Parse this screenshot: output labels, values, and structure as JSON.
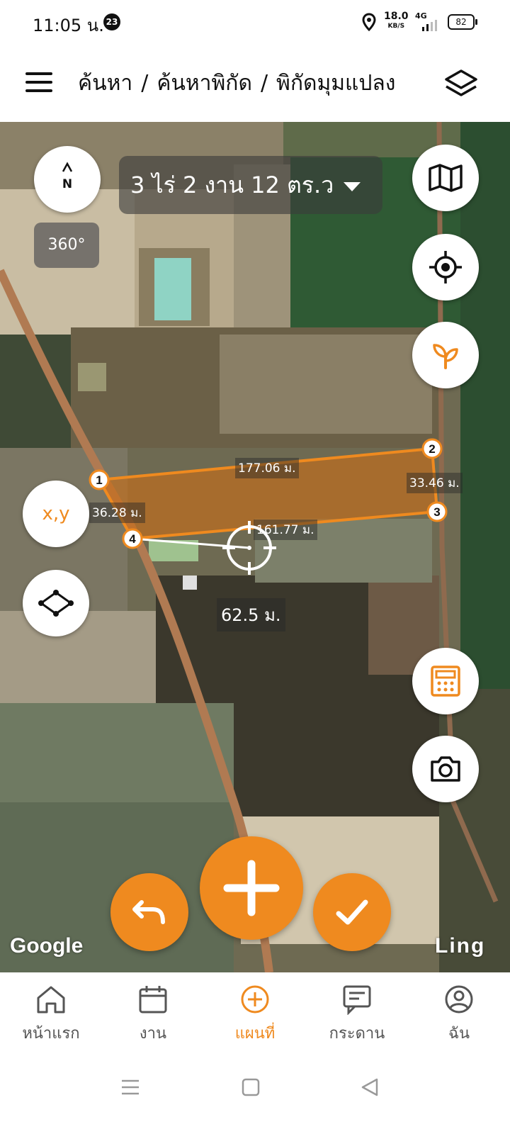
{
  "status_bar": {
    "time": "11:05 น.",
    "notification_count": "23",
    "speed_value": "18.0",
    "speed_unit": "KB/S",
    "network": "4G",
    "battery": "82"
  },
  "header": {
    "breadcrumbs": [
      "ค้นหา",
      "ค้นหาพิกัด",
      "พิกัดมุมแปลง"
    ],
    "separator": "/"
  },
  "map": {
    "area_label": "3 ไร่ 2 งาน 12 ตร.ว",
    "compass_letter": "N",
    "rotation_label": "360°",
    "xy_label": "x,y",
    "corners": [
      "1",
      "2",
      "3",
      "4"
    ],
    "dimensions": {
      "top": "177.06 ม.",
      "right": "33.46 ม.",
      "left": "36.28 ม.",
      "bottom": "161.77 ม."
    },
    "cursor_distance": "62.5 ม.",
    "attribution_left": "Google",
    "attribution_right": "Ling",
    "accent_color": "#ef8a1f"
  },
  "side_buttons": {
    "right": [
      "map-icon",
      "locate-icon",
      "plant-icon",
      "calculator-icon",
      "camera-icon"
    ],
    "left": [
      "compass-icon",
      "xy-coordinate-icon",
      "polygon-icon"
    ]
  },
  "actions": [
    "undo-icon",
    "add-icon",
    "check-icon"
  ],
  "bottom_nav": [
    {
      "label": "หน้าแรก",
      "icon": "home-icon",
      "active": false
    },
    {
      "label": "งาน",
      "icon": "calendar-icon",
      "active": false
    },
    {
      "label": "แผนที่",
      "icon": "map-add-icon",
      "active": true
    },
    {
      "label": "กระดาน",
      "icon": "board-icon",
      "active": false
    },
    {
      "label": "ฉัน",
      "icon": "profile-icon",
      "active": false
    }
  ]
}
